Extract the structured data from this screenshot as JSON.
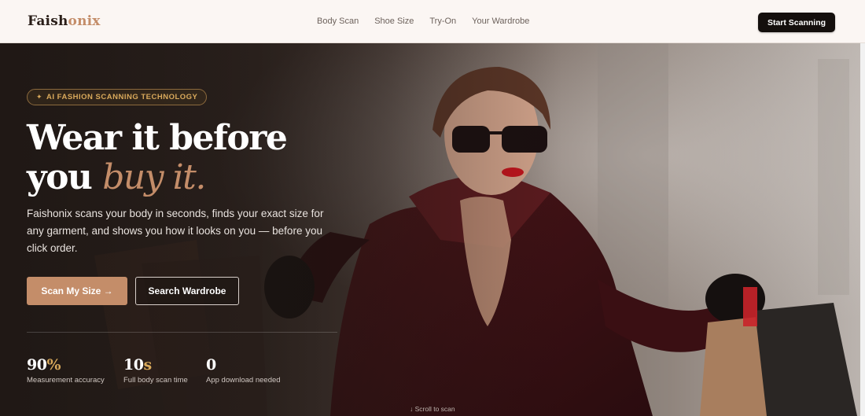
{
  "nav": {
    "logo_main": "Faish",
    "logo_accent": "onix",
    "links": [
      "Body Scan",
      "Shoe Size",
      "Try-On",
      "Your Wardrobe"
    ],
    "cta": "Start Scanning"
  },
  "hero": {
    "badge": "AI FASHION SCANNING TECHNOLOGY",
    "badge_icon": "✦",
    "headline_line1": "Wear it before",
    "headline_line2_plain": "you",
    "headline_line2_italic": "buy it.",
    "subtext": "Faishonix scans your body in seconds, finds your exact size for any garment, and shows you how it looks on you — before you click order.",
    "primary_button": "Scan My Size →",
    "secondary_button": "Search Wardrobe",
    "stats": [
      {
        "value": "90",
        "unit": "%",
        "label": "Measurement accuracy"
      },
      {
        "value": "10",
        "unit": "s",
        "label": "Full body scan time"
      },
      {
        "value": "0",
        "unit": "",
        "label": "App download needed"
      }
    ],
    "scroll_hint": "↓ Scroll to scan"
  },
  "colors": {
    "accent": "#c48d69",
    "gold": "#d9a95b",
    "dark": "#140f0d",
    "nav_bg": "#fbf6f3"
  }
}
